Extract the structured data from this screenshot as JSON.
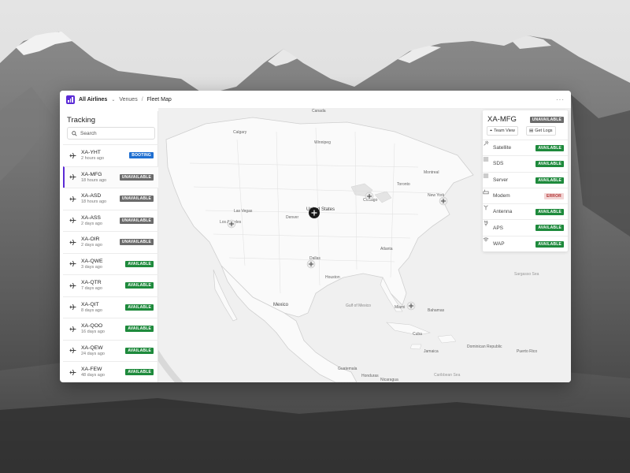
{
  "colors": {
    "accent": "#5b2bd6",
    "available_bg": "#1e8a3c",
    "unavailable_bg": "#6b6b6b",
    "booting_bg": "#1f6fd1",
    "error_bg": "#f3d6d6",
    "error_fg": "#b03030"
  },
  "topbar": {
    "org": "All Airlines",
    "crumb_venues": "Venues",
    "separator": "/",
    "crumb_current": "Fleet Map",
    "more_label": "···"
  },
  "sidebar": {
    "title": "Tracking",
    "search_placeholder": "Search",
    "flights": [
      {
        "id": "XA-YHT",
        "time": "2 hours ago",
        "status": "BOOTING",
        "selected": false
      },
      {
        "id": "XA-MFG",
        "time": "18 hours ago",
        "status": "UNAVAILABLE",
        "selected": true
      },
      {
        "id": "XA-ASD",
        "time": "18 hours ago",
        "status": "UNAVAILABLE",
        "selected": false
      },
      {
        "id": "XA-ASS",
        "time": "2 days ago",
        "status": "UNAVAILABLE",
        "selected": false
      },
      {
        "id": "XA-OIR",
        "time": "2 days ago",
        "status": "UNAVAILABLE",
        "selected": false
      },
      {
        "id": "XA-QWE",
        "time": "3 days ago",
        "status": "AVAILABLE",
        "selected": false
      },
      {
        "id": "XA-QTR",
        "time": "7 days ago",
        "status": "AVAILABLE",
        "selected": false
      },
      {
        "id": "XA-QIT",
        "time": "8 days ago",
        "status": "AVAILABLE",
        "selected": false
      },
      {
        "id": "XA-QOO",
        "time": "16 days ago",
        "status": "AVAILABLE",
        "selected": false
      },
      {
        "id": "XA-QEW",
        "time": "24 days ago",
        "status": "AVAILABLE",
        "selected": false
      },
      {
        "id": "XA-FEW",
        "time": "48 days ago",
        "status": "AVAILABLE",
        "selected": false
      }
    ]
  },
  "panel": {
    "title": "XA-MFG",
    "status": "UNAVAILABLE",
    "team_view_label": "Team View",
    "get_logs_label": "Get Logs",
    "services": [
      {
        "label": "Satellite",
        "status": "AVAILABLE",
        "icon": "satellite-icon"
      },
      {
        "label": "SDS",
        "status": "AVAILABLE",
        "icon": "list-icon"
      },
      {
        "label": "Server",
        "status": "AVAILABLE",
        "icon": "list-icon"
      },
      {
        "label": "Modem",
        "status": "ERROR",
        "icon": "modem-icon"
      },
      {
        "label": "Antenna",
        "status": "AVAILABLE",
        "icon": "antenna-icon"
      },
      {
        "label": "APS",
        "status": "AVAILABLE",
        "icon": "plug-icon"
      },
      {
        "label": "WAP",
        "status": "AVAILABLE",
        "icon": "wifi-icon"
      }
    ]
  },
  "map": {
    "labels": {
      "canada": "Canada",
      "united_states": "United States",
      "mexico": "Mexico",
      "cuba": "Cuba",
      "gulf": "Gulf of Mexico",
      "sargasso": "Sargasso Sea",
      "caribbean": "Caribbean Sea",
      "bahamas": "Bahamas",
      "guatemala": "Guatemala",
      "honduras": "Honduras",
      "jamaica": "Jamaica",
      "dominican": "Dominican Republic",
      "puerto_rico": "Puerto Rico",
      "nicaragua": "Nicaragua",
      "los_angeles": "Los Angeles",
      "las_vegas": "Las Vegas",
      "chicago": "Chicago",
      "toronto": "Toronto",
      "montreal": "Montreal",
      "new_york": "New York",
      "dallas": "Dallas",
      "houston": "Houston",
      "atlanta": "Atlanta",
      "miami": "Miami",
      "denver": "Denver",
      "calgary": "Calgary",
      "winnipeg": "Winnipeg"
    }
  }
}
